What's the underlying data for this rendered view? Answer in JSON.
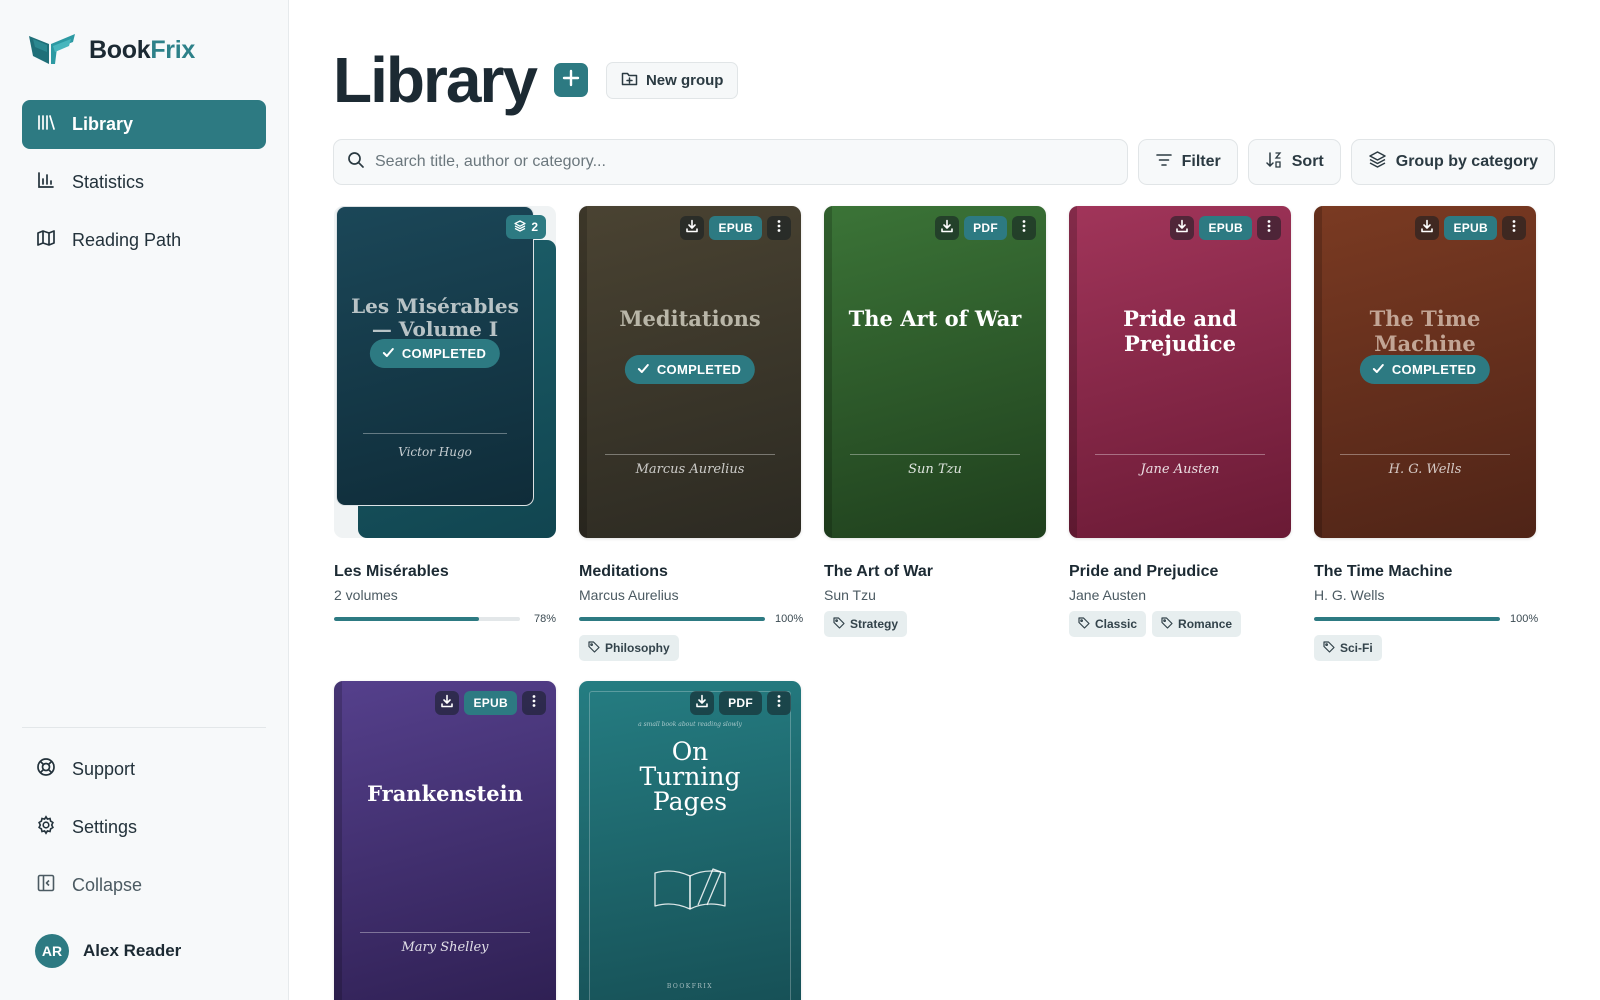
{
  "brand": {
    "name_part1": "Book",
    "name_part2": "Frix"
  },
  "sidebar": {
    "items": [
      {
        "label": "Library",
        "icon": "library-icon",
        "active": true
      },
      {
        "label": "Statistics",
        "icon": "bar-chart-icon",
        "active": false
      },
      {
        "label": "Reading Path",
        "icon": "map-icon",
        "active": false
      }
    ],
    "bottom": [
      {
        "label": "Support",
        "icon": "lifebuoy-icon"
      },
      {
        "label": "Settings",
        "icon": "gear-icon"
      },
      {
        "label": "Collapse",
        "icon": "collapse-icon"
      }
    ],
    "user": {
      "initials": "AR",
      "name": "Alex Reader"
    }
  },
  "header": {
    "title": "Library",
    "new_group_label": "New group"
  },
  "toolbar": {
    "search_placeholder": "Search title, author or category...",
    "filter_label": "Filter",
    "sort_label": "Sort",
    "group_label": "Group by category"
  },
  "colors": {
    "accent": "#2d7a82"
  },
  "books": [
    {
      "cover_title": "Les Misérables — Volume I",
      "cover_author": "Victor Hugo",
      "title": "Les Misérables",
      "subtitle": "2 volumes",
      "completed_label": "COMPLETED",
      "stack_count": "2",
      "progress_pct": 78,
      "progress_label": "78%",
      "tags": []
    },
    {
      "cover_title": "Meditations",
      "cover_author": "Marcus Aurelius",
      "title": "Meditations",
      "subtitle": "Marcus Aurelius",
      "format": "EPUB",
      "completed_label": "COMPLETED",
      "progress_pct": 100,
      "progress_label": "100%",
      "tags": [
        "Philosophy"
      ]
    },
    {
      "cover_title": "The Art of War",
      "cover_author": "Sun Tzu",
      "title": "The Art of War",
      "subtitle": "Sun Tzu",
      "format": "PDF",
      "tags": [
        "Strategy"
      ]
    },
    {
      "cover_title": "Pride and Prejudice",
      "cover_author": "Jane Austen",
      "title": "Pride and Prejudice",
      "subtitle": "Jane Austen",
      "format": "EPUB",
      "tags": [
        "Classic",
        "Romance"
      ]
    },
    {
      "cover_title": "The Time Machine",
      "cover_author": "H. G. Wells",
      "title": "The Time Machine",
      "subtitle": "H. G. Wells",
      "format": "EPUB",
      "completed_label": "COMPLETED",
      "progress_pct": 100,
      "progress_label": "100%",
      "tags": [
        "Sci-Fi"
      ]
    },
    {
      "cover_title": "Frankenstein",
      "cover_author": "Mary Shelley",
      "format": "EPUB"
    },
    {
      "cover_kicker": "a small book about reading slowly",
      "cover_title": "On Turning Pages",
      "cover_publisher": "BOOKFRIX",
      "format": "PDF"
    }
  ]
}
